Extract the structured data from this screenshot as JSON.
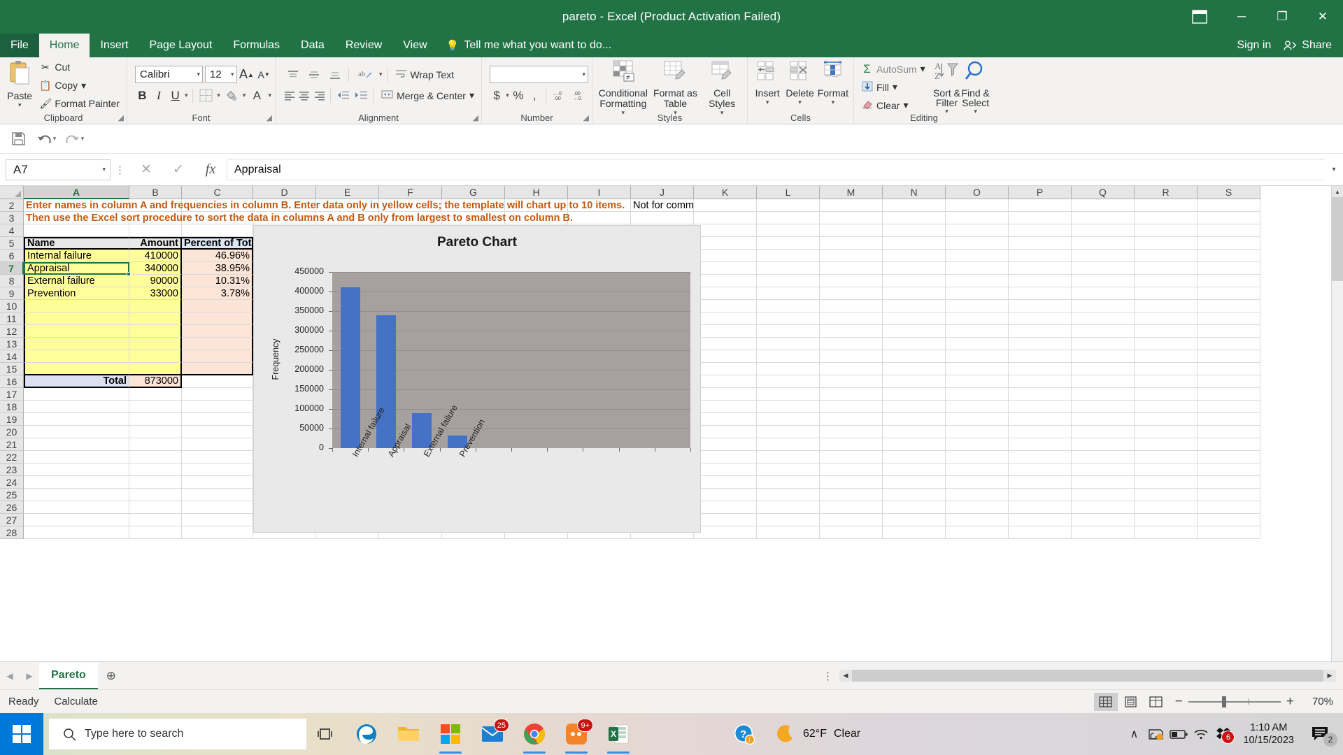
{
  "window": {
    "title": "pareto - Excel (Product Activation Failed)",
    "ribbon_display_icon": "ribbon-display-options-icon",
    "minimize": "─",
    "maximize": "❐",
    "close": "✕"
  },
  "tabs": {
    "file": "File",
    "items": [
      "Home",
      "Insert",
      "Page Layout",
      "Formulas",
      "Data",
      "Review",
      "View"
    ],
    "active": "Home",
    "tellme": "Tell me what you want to do...",
    "signin": "Sign in",
    "share": "Share"
  },
  "ribbon": {
    "clipboard": {
      "group": "Clipboard",
      "paste": "Paste",
      "cut": "Cut",
      "copy": "Copy",
      "format_painter": "Format Painter"
    },
    "font": {
      "group": "Font",
      "family": "Calibri",
      "size": "12",
      "grow": "A",
      "shrink": "A",
      "bold": "B",
      "italic": "I",
      "underline": "U",
      "borders": "borders-icon",
      "fill": "fill-color-icon",
      "color": "A"
    },
    "alignment": {
      "group": "Alignment",
      "wrap_text": "Wrap Text",
      "merge_center": "Merge & Center"
    },
    "number": {
      "group": "Number",
      "format_value": "",
      "currency": "$",
      "percent": "%",
      "comma": ",",
      "dec_inc": ".00",
      "dec_dec": ".00"
    },
    "styles": {
      "group": "Styles",
      "conditional_formatting": "Conditional Formatting",
      "format_as_table": "Format as Table",
      "cell_styles": "Cell Styles"
    },
    "cells": {
      "group": "Cells",
      "insert": "Insert",
      "delete": "Delete",
      "format": "Format"
    },
    "editing": {
      "group": "Editing",
      "autosum": "AutoSum",
      "fill": "Fill",
      "clear": "Clear",
      "sort_filter": "Sort & Filter",
      "find_select": "Find & Select"
    }
  },
  "quick_access": {
    "save": "save-icon",
    "undo": "undo-icon",
    "redo": "redo-icon"
  },
  "formula_bar": {
    "name_box": "A7",
    "cancel": "✕",
    "enter": "✓",
    "fx": "fx",
    "value": "Appraisal"
  },
  "grid": {
    "columns": [
      "A",
      "B",
      "C",
      "D",
      "E",
      "F",
      "G",
      "H",
      "I",
      "J",
      "K",
      "L",
      "M",
      "N",
      "O",
      "P",
      "Q",
      "R",
      "S"
    ],
    "selected_column": "A",
    "rows": [
      2,
      3,
      4,
      5,
      6,
      7,
      8,
      9,
      10,
      11,
      12,
      13,
      14,
      15,
      16,
      17,
      18,
      19,
      20,
      21,
      22,
      23,
      24,
      25,
      26,
      27,
      28
    ],
    "selected_row": 7,
    "notes": {
      "line1": "Enter names in column A and frequencies in column B.  Enter data only in yellow cells; the template will chart up to 10 items.",
      "line2": "Then use the Excel sort procedure to sort the data in columns A and B only from largest to smallest on column B.",
      "commercial": "Not for commercial use."
    },
    "table": {
      "headers": [
        "Name",
        "Amount",
        "Percent of Total"
      ],
      "rows": [
        {
          "name": "Internal failure",
          "amount": "410000",
          "percent": "46.96%"
        },
        {
          "name": "Appraisal",
          "amount": "340000",
          "percent": "38.95%"
        },
        {
          "name": "External failure",
          "amount": "90000",
          "percent": "10.31%"
        },
        {
          "name": "Prevention",
          "amount": "33000",
          "percent": "3.78%"
        },
        {
          "name": "",
          "amount": "",
          "percent": ""
        },
        {
          "name": "",
          "amount": "",
          "percent": ""
        },
        {
          "name": "",
          "amount": "",
          "percent": ""
        },
        {
          "name": "",
          "amount": "",
          "percent": ""
        },
        {
          "name": "",
          "amount": "",
          "percent": ""
        },
        {
          "name": "",
          "amount": "",
          "percent": ""
        }
      ],
      "total_label": "Total",
      "total_value": "873000"
    }
  },
  "chart_data": {
    "type": "bar",
    "title": "Pareto Chart",
    "xlabel": "",
    "ylabel": "Frequency",
    "categories": [
      "Internal failure",
      "Appraisal",
      "External failure",
      "Prevention"
    ],
    "values": [
      410000,
      340000,
      90000,
      33000
    ],
    "yticks": [
      0,
      50000,
      100000,
      150000,
      200000,
      250000,
      300000,
      350000,
      400000,
      450000
    ],
    "ytick_labels": [
      "0",
      "50000",
      "100000",
      "150000",
      "200000",
      "250000",
      "300000",
      "350000",
      "400000",
      "450000"
    ],
    "ylim": [
      0,
      450000
    ],
    "grid": true,
    "legend": "none",
    "series_color": "#4472C4",
    "plot_bg": "#a6a19e",
    "chart_bg": "#e9e9e9",
    "n_category_slots": 10
  },
  "sheet_tabs": {
    "prev": "◀",
    "next": "▶",
    "active": "Pareto",
    "add": "⊕"
  },
  "status_bar": {
    "ready": "Ready",
    "calculate": "Calculate",
    "view_normal": "normal-view-icon",
    "view_page_layout": "page-layout-view-icon",
    "view_page_break": "page-break-view-icon",
    "zoom_out": "−",
    "zoom_in": "+",
    "zoom_level": "70%"
  },
  "taskbar": {
    "start": "start-button",
    "search_placeholder": "Type here to search",
    "task_view": "task-view-icon",
    "apps": [
      {
        "name": "edge-icon",
        "badge": ""
      },
      {
        "name": "file-explorer-icon",
        "badge": ""
      },
      {
        "name": "microsoft-store-icon",
        "badge": ""
      },
      {
        "name": "mail-icon",
        "badge": "25"
      },
      {
        "name": "chrome-icon",
        "badge": ""
      },
      {
        "name": "app-icon-orange",
        "badge": "9+"
      },
      {
        "name": "excel-icon",
        "badge": ""
      }
    ],
    "help_icon": "help-icon",
    "weather_temp": "62°F",
    "weather_cond": "Clear",
    "tray": {
      "chevron": "∧",
      "onedrive": "onedrive-icon",
      "battery": "battery-icon",
      "wifi": "wifi-icon",
      "dropbox_badge": "6",
      "time": "1:10 AM",
      "date": "10/15/2023",
      "notifications": "2"
    }
  }
}
